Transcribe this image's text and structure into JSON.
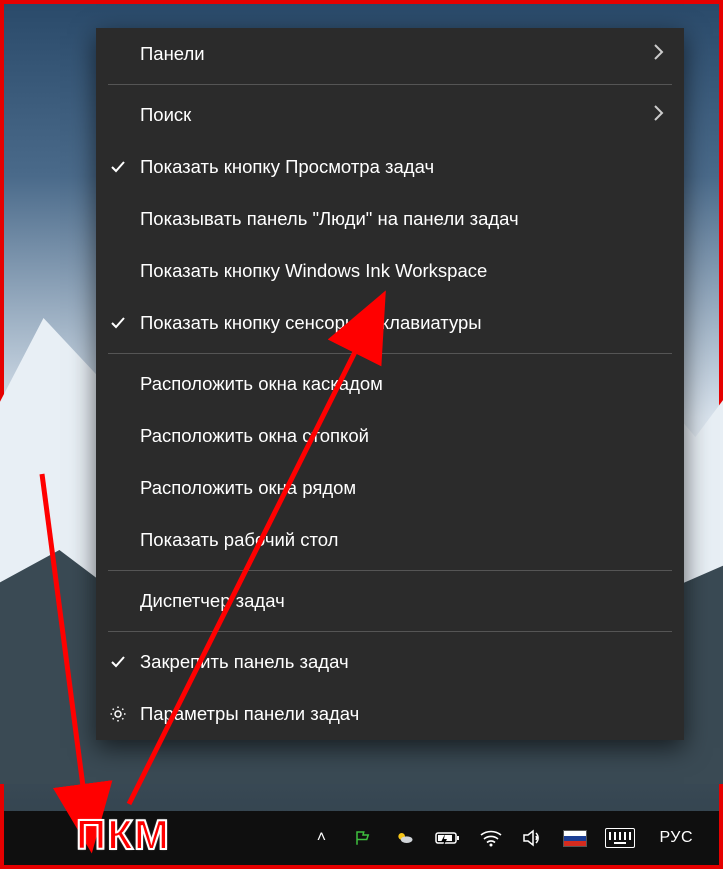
{
  "annotation": {
    "label": "ПКМ"
  },
  "menu": {
    "items": [
      {
        "label": "Панели",
        "checked": false,
        "submenu": true,
        "icon": null
      },
      {
        "sep": true
      },
      {
        "label": "Поиск",
        "checked": false,
        "submenu": true,
        "icon": null
      },
      {
        "label": "Показать кнопку Просмотра задач",
        "checked": true,
        "submenu": false,
        "icon": null
      },
      {
        "label": "Показывать панель \"Люди\" на панели задач",
        "checked": false,
        "submenu": false,
        "icon": null
      },
      {
        "label": "Показать кнопку Windows Ink Workspace",
        "checked": false,
        "submenu": false,
        "icon": null
      },
      {
        "label": "Показать кнопку сенсорной клавиатуры",
        "checked": true,
        "submenu": false,
        "icon": null
      },
      {
        "sep": true
      },
      {
        "label": "Расположить окна каскадом",
        "checked": false,
        "submenu": false,
        "icon": null
      },
      {
        "label": "Расположить окна стопкой",
        "checked": false,
        "submenu": false,
        "icon": null
      },
      {
        "label": "Расположить окна рядом",
        "checked": false,
        "submenu": false,
        "icon": null
      },
      {
        "label": "Показать рабочий стол",
        "checked": false,
        "submenu": false,
        "icon": null
      },
      {
        "sep": true
      },
      {
        "label": "Диспетчер задач",
        "checked": false,
        "submenu": false,
        "icon": null
      },
      {
        "sep": true
      },
      {
        "label": "Закрепить панель задач",
        "checked": true,
        "submenu": false,
        "icon": null
      },
      {
        "label": "Параметры панели задач",
        "checked": false,
        "submenu": false,
        "icon": "gear"
      }
    ]
  },
  "taskbar": {
    "tray_up": "˄",
    "language": "РУС",
    "icons": {
      "action_center_flag": "flag-icon",
      "weather": "weather-icon",
      "battery": "battery-icon",
      "wifi": "wifi-icon",
      "volume": "volume-icon",
      "input_flag": "russia-flag",
      "keyboard": "osk-icon"
    }
  }
}
